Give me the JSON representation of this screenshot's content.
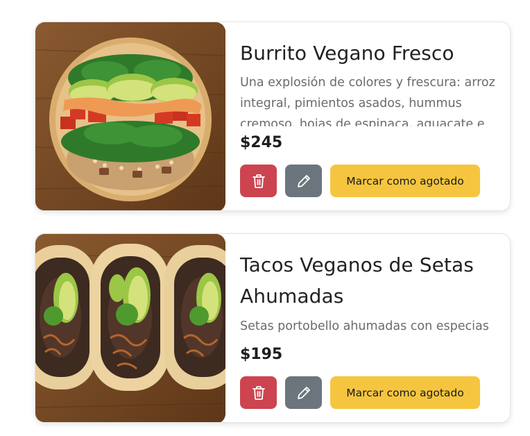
{
  "products": [
    {
      "name": "Burrito Vegano Fresco",
      "description": "Una explosión de colores y frescura: arroz integral, pimientos asados, hummus cremoso, hojas de espinaca, aguacate e",
      "price": "$245",
      "image_icon": "burrito-photo",
      "actions": {
        "delete_icon": "trash-icon",
        "edit_icon": "pencil-icon",
        "soldout_label": "Marcar como agotado"
      }
    },
    {
      "name": "Tacos Veganos de Setas Ahumadas",
      "description": "Setas portobello ahumadas con especias",
      "price": "$195",
      "image_icon": "tacos-photo",
      "actions": {
        "delete_icon": "trash-icon",
        "edit_icon": "pencil-icon",
        "soldout_label": "Marcar como agotado"
      }
    }
  ],
  "colors": {
    "delete": "#cc4450",
    "edit": "#6c757d",
    "soldout": "#f6c53f",
    "title": "#222222",
    "description": "#6b6b6b"
  }
}
